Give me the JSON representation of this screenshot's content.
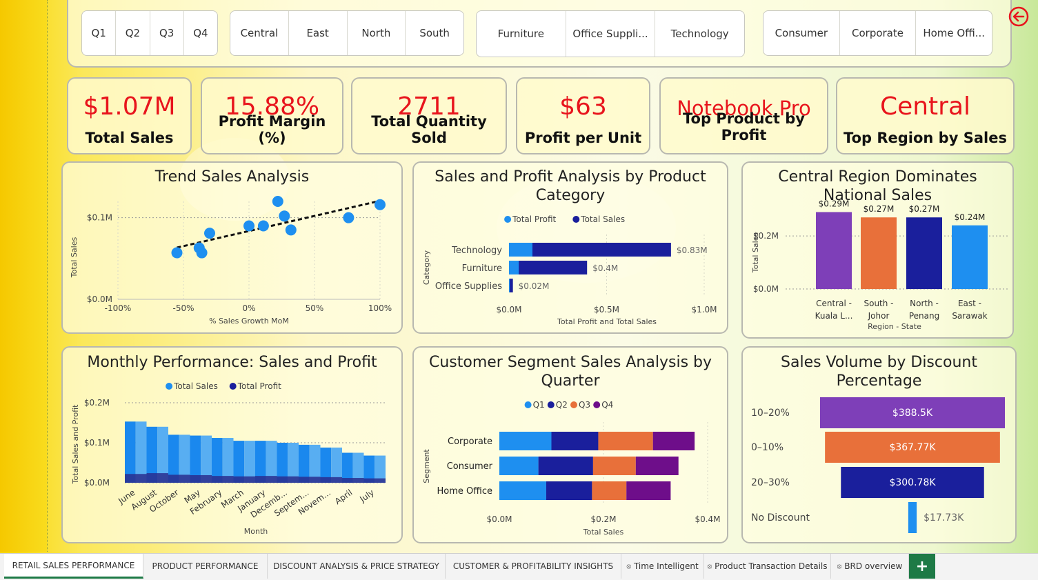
{
  "slicers": {
    "quarters": [
      "Q1",
      "Q2",
      "Q3",
      "Q4"
    ],
    "regions": [
      "Central",
      "East",
      "North",
      "South"
    ],
    "categories": [
      "Furniture",
      "Office Suppli...",
      "Technology"
    ],
    "segments": [
      "Consumer",
      "Corporate",
      "Home Offi..."
    ]
  },
  "kpis": [
    {
      "value": "$1.07M",
      "label": "Total Sales"
    },
    {
      "value": "15.88%",
      "label": "Profit Margin (%)"
    },
    {
      "value": "2711",
      "label": "Total Quantity Sold"
    },
    {
      "value": "$63",
      "label": "Profit per Unit"
    },
    {
      "value": "Notebook Pro",
      "label": "Top Product by Profit"
    },
    {
      "value": "Central",
      "label": "Top Region by Sales"
    }
  ],
  "back_icon": "back-arrow-icon",
  "colors": {
    "accent_red": "#e8141c",
    "light_blue": "#1e8ff0",
    "navy": "#1a1f9c",
    "orange": "#e8703a",
    "purple": "#7e3fb8",
    "dark_purple": "#6e0e8a",
    "tab_green": "#1e7a46"
  },
  "tabs": [
    {
      "label": "RETAIL SALES PERFORMANCE",
      "active": true,
      "hidden": false
    },
    {
      "label": "PRODUCT PERFORMANCE",
      "hidden": false
    },
    {
      "label": "DISCOUNT ANALYSIS & PRICE STRATEGY",
      "hidden": false
    },
    {
      "label": "CUSTOMER & PROFITABILITY INSIGHTS",
      "hidden": false
    },
    {
      "label": "Time Intelligent",
      "hidden": true
    },
    {
      "label": "Product Transaction Details",
      "hidden": true
    },
    {
      "label": "BRD overview",
      "hidden": true
    }
  ],
  "add_tab_label": "+",
  "chart_data": [
    {
      "id": "trend",
      "type": "scatter",
      "title": "Trend Sales Analysis",
      "xlabel": "% Sales Growth MoM",
      "ylabel": "Total Sales",
      "xlim": [
        -100,
        100
      ],
      "ylim": [
        0,
        0.12
      ],
      "x_ticks": [
        "-100%",
        "-50%",
        "0%",
        "50%",
        "100%"
      ],
      "y_ticks": [
        "$0.0M",
        "$0.1M"
      ],
      "points": [
        [
          -55,
          0.057
        ],
        [
          -38,
          0.063
        ],
        [
          -36,
          0.057
        ],
        [
          -30,
          0.081
        ],
        [
          0,
          0.09
        ],
        [
          11,
          0.09
        ],
        [
          22,
          0.12
        ],
        [
          27,
          0.102
        ],
        [
          32,
          0.085
        ],
        [
          76,
          0.1
        ],
        [
          100,
          0.116
        ]
      ],
      "trendline": true,
      "grid": true
    },
    {
      "id": "category",
      "type": "bar",
      "orientation": "horizontal",
      "title": "Sales and Profit Analysis by Product Category",
      "xlabel": "Total Profit and Total Sales",
      "ylabel": "Category",
      "categories": [
        "Technology",
        "Furniture",
        "Office Supplies"
      ],
      "series": [
        {
          "name": "Total Profit",
          "values": [
            0.12,
            0.05,
            0.004
          ]
        },
        {
          "name": "Total Sales",
          "values": [
            0.83,
            0.4,
            0.02
          ]
        }
      ],
      "data_labels": [
        "$0.83M",
        "$0.4M",
        "$0.02M"
      ],
      "x_ticks": [
        "$0.0M",
        "$0.5M",
        "$1.0M"
      ],
      "xlim": [
        0,
        1.0
      ],
      "legend": "top"
    },
    {
      "id": "region",
      "type": "bar",
      "title": "Central Region Dominates National Sales",
      "xlabel": "Region - State",
      "ylabel": "Total Sales",
      "categories": [
        "Central - Kuala L...",
        "South - Johor",
        "North - Penang",
        "East - Sarawak"
      ],
      "values": [
        0.29,
        0.27,
        0.27,
        0.24
      ],
      "data_labels": [
        "$0.29M",
        "$0.27M",
        "$0.27M",
        "$0.24M"
      ],
      "y_ticks": [
        "$0.0M",
        "$0.2M"
      ],
      "ylim": [
        0,
        0.32
      ]
    },
    {
      "id": "monthly",
      "type": "area",
      "title": "Monthly Performance: Sales and Profit",
      "xlabel": "Month",
      "ylabel": "Total Sales and Profit",
      "categories": [
        "June",
        "August",
        "October",
        "May",
        "February",
        "March",
        "January",
        "Decemb...",
        "Septem...",
        "Novem...",
        "April",
        "July"
      ],
      "series": [
        {
          "name": "Total Sales",
          "values": [
            0.153,
            0.14,
            0.12,
            0.118,
            0.112,
            0.105,
            0.105,
            0.1,
            0.095,
            0.088,
            0.075,
            0.068
          ]
        },
        {
          "name": "Total Profit",
          "values": [
            0.022,
            0.024,
            0.02,
            0.019,
            0.017,
            0.016,
            0.017,
            0.016,
            0.015,
            0.014,
            0.012,
            0.011
          ]
        }
      ],
      "y_ticks": [
        "$0.0M",
        "$0.1M",
        "$0.2M"
      ],
      "ylim": [
        0,
        0.2
      ],
      "legend": "top"
    },
    {
      "id": "segment",
      "type": "bar",
      "orientation": "horizontal",
      "stacked": true,
      "title": "Customer Segment Sales Analysis by Quarter",
      "xlabel": "Total Sales",
      "ylabel": "Segment",
      "categories": [
        "Corporate",
        "Consumer",
        "Home Office"
      ],
      "series": [
        {
          "name": "Q1",
          "values": [
            0.1,
            0.075,
            0.09
          ]
        },
        {
          "name": "Q2",
          "values": [
            0.09,
            0.105,
            0.088
          ]
        },
        {
          "name": "Q3",
          "values": [
            0.105,
            0.082,
            0.066
          ]
        },
        {
          "name": "Q4",
          "values": [
            0.08,
            0.082,
            0.085
          ]
        }
      ],
      "x_ticks": [
        "$0.0M",
        "$0.2M",
        "$0.4M"
      ],
      "xlim": [
        0,
        0.4
      ],
      "legend": "top"
    },
    {
      "id": "discount",
      "type": "bar",
      "subtype": "funnel",
      "title": "Sales Volume by Discount Percentage",
      "categories": [
        "10–20%",
        "0–10%",
        "20–30%",
        "No Discount"
      ],
      "values": [
        388.5,
        367.77,
        300.78,
        17.73
      ],
      "data_labels": [
        "$388.5K",
        "$367.77K",
        "$300.78K",
        "$17.73K"
      ]
    }
  ]
}
